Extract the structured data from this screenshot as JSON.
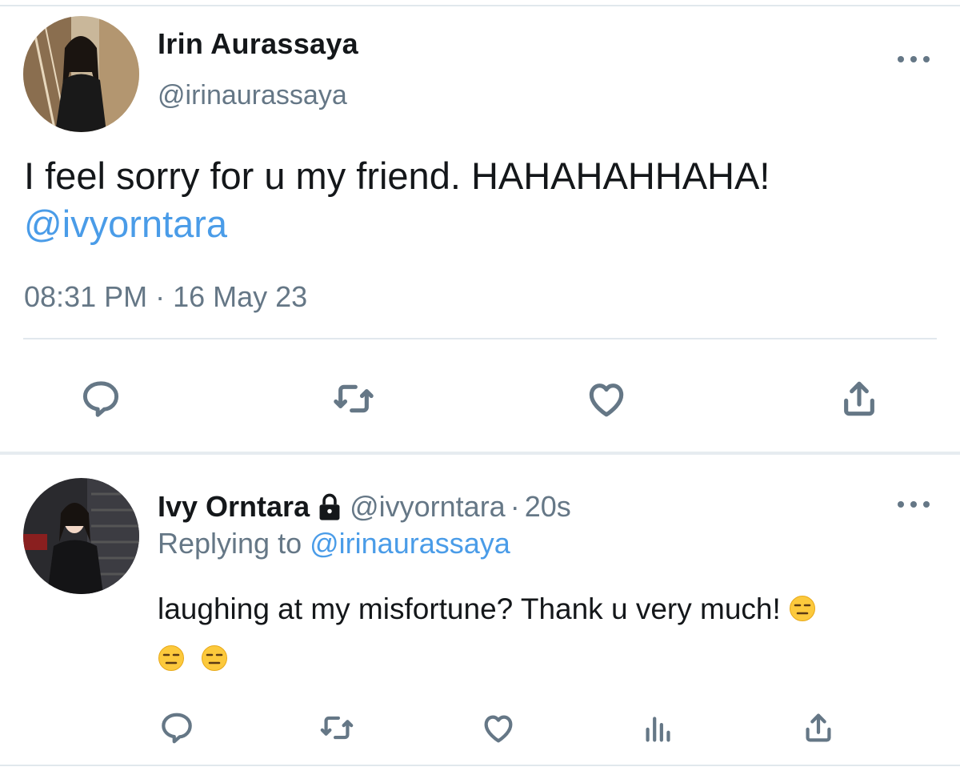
{
  "main_tweet": {
    "display_name": "Irin Aurassaya",
    "handle": "@irinaurassaya",
    "text": "I feel sorry for u my friend. HAHAHAHHAHA!",
    "mention": "@ivyorntara",
    "timestamp": "08:31 PM · 16 May 23",
    "actions": [
      "reply-icon",
      "retweet-icon",
      "like-icon",
      "share-icon"
    ]
  },
  "reply_tweet": {
    "display_name": "Ivy Orntara",
    "handle": "@ivyorntara",
    "separator": "·",
    "time_ago": "20s",
    "replying_prefix": "Replying to",
    "replying_to": "@irinaurassaya",
    "text": "laughing at my misfortune? Thank u very much!",
    "emoji": "expressionless-face",
    "actions": [
      "reply-icon",
      "retweet-icon",
      "like-icon",
      "analytics-icon",
      "share-icon"
    ]
  },
  "colors": {
    "link": "#4a9ce8",
    "secondary_text": "#657786",
    "divider": "#e1e8ed"
  }
}
